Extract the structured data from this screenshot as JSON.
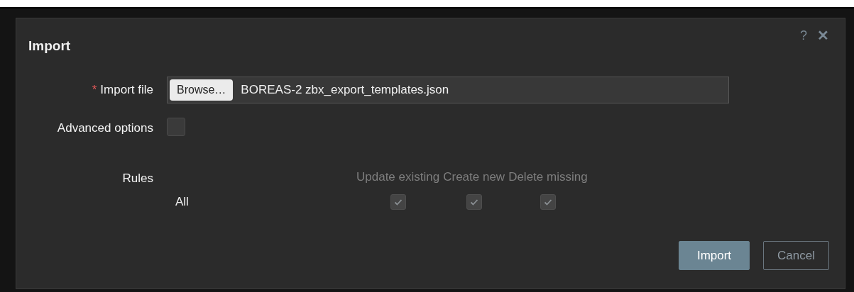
{
  "dialog": {
    "title": "Import",
    "help": "?",
    "close": "✕",
    "import_file": {
      "label": "Import file",
      "required": true,
      "required_marker": "*",
      "browse": "Browse…",
      "value": "BOREAS-2 zbx_export_templates.json"
    },
    "advanced_options": {
      "label": "Advanced options",
      "checked": false
    },
    "rules": {
      "label": "Rules",
      "columns": [
        "Update existing",
        "Create new",
        "Delete missing"
      ],
      "rows": [
        {
          "name": "All",
          "options": [
            {
              "checked": true,
              "disabled": true
            },
            {
              "checked": true,
              "disabled": true
            },
            {
              "checked": true,
              "disabled": true
            }
          ]
        }
      ]
    },
    "buttons": [
      {
        "label": "Import",
        "kind": "primary"
      },
      {
        "label": "Cancel",
        "kind": "secondary"
      }
    ]
  }
}
